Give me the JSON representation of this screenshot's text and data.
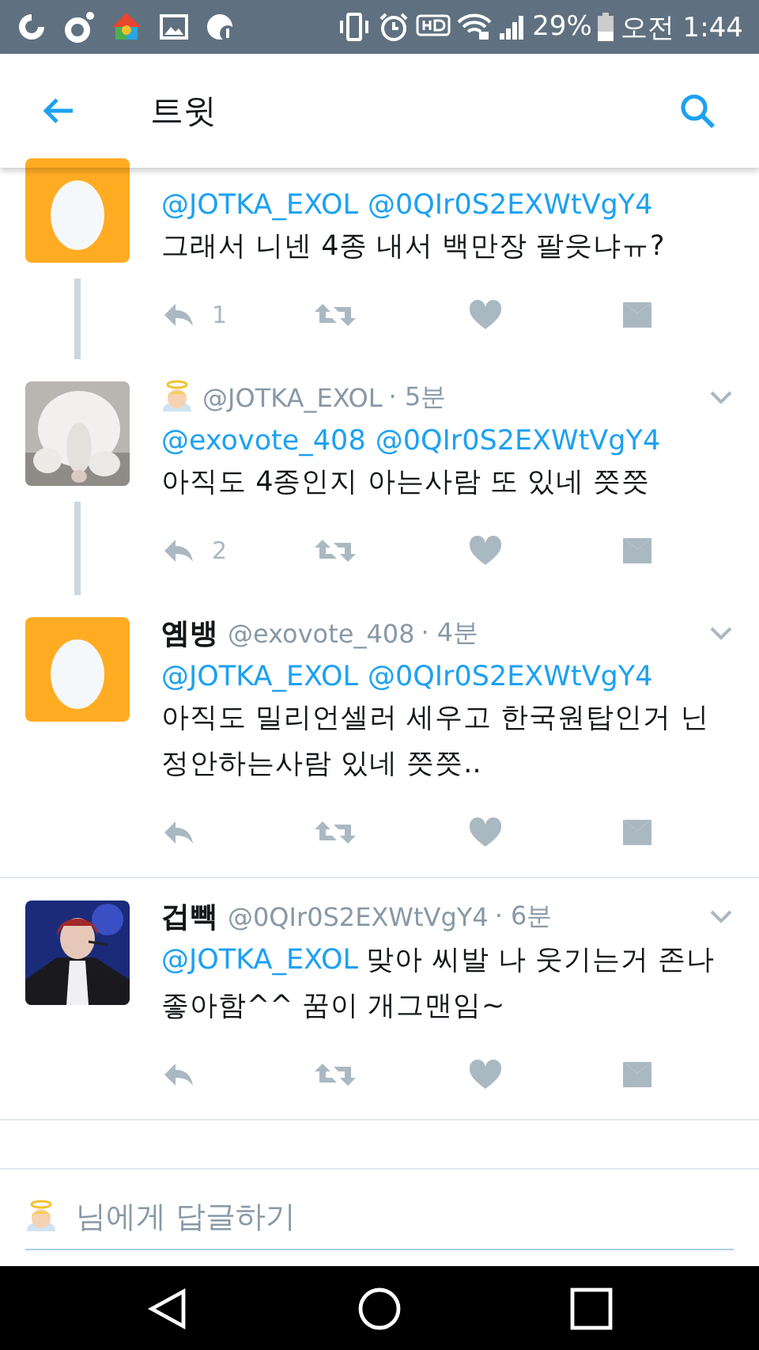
{
  "status_bar": {
    "battery": "29%",
    "time": "오전 1:44"
  },
  "app_bar": {
    "title": "트윗"
  },
  "tweets": [
    {
      "kind": "egg",
      "mentions": [
        "@JOTKA_EXOL",
        "@0QIr0S2EXWtVgY4"
      ],
      "mentions_inline": false,
      "text": "그래서 니넨 4종 내서 백만장 팔읏냐ㅠ?",
      "reply_count": "1",
      "thread_below": true
    },
    {
      "kind": "picture",
      "name_icon": true,
      "handle": "@JOTKA_EXOL",
      "time": "· 5분",
      "mentions": [
        "@exovote_408",
        "@0QIr0S2EXWtVgY4"
      ],
      "mentions_inline": false,
      "text": "아직도 4종인지 아는사람 또 있네 쯧쯧",
      "reply_count": "2",
      "thread_below": true
    },
    {
      "kind": "egg",
      "name": "옘뱅",
      "handle": "@exovote_408",
      "time": "· 4분",
      "mentions": [
        "@JOTKA_EXOL",
        "@0QIr0S2EXWtVgY4"
      ],
      "mentions_inline": false,
      "text": "아직도 밀리언셀러 세우고 한국원탑인거 닌정안하는사람 있네 쯧쯧..",
      "thread_below": false
    },
    {
      "kind": "person",
      "name": "겁빽",
      "handle": "@0QIr0S2EXWtVgY4",
      "time": "· 6분",
      "mentions": [
        "@JOTKA_EXOL"
      ],
      "mentions_inline": true,
      "text": "맞아 씨발 나 웃기는거 존나 좋아함^^ 꿈이 개그맨임~",
      "thread_below": false
    }
  ],
  "reply_field": {
    "placeholder": "님에게 답글하기"
  }
}
